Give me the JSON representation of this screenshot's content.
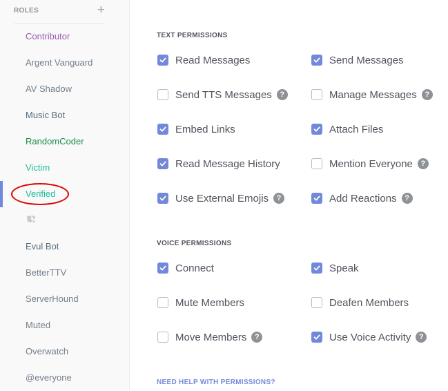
{
  "sidebar": {
    "title": "ROLES",
    "add_icon": "+",
    "items": [
      {
        "label": "Contributor",
        "color": "#9b59b6",
        "selected": false
      },
      {
        "label": "Argent Vanguard",
        "color": "#737f8d",
        "selected": false
      },
      {
        "label": "AV Shadow",
        "color": "#737f8d",
        "selected": false
      },
      {
        "label": "Music Bot",
        "color": "#546e7a",
        "selected": false
      },
      {
        "label": "RandomCoder",
        "color": "#1f8b4c",
        "selected": false
      },
      {
        "label": "Victim",
        "color": "#1abc9c",
        "selected": false
      },
      {
        "label": "Verified",
        "color": "#1abc9c",
        "selected": true
      },
      {
        "label": "",
        "icon": "broken-image-icon",
        "color": "#b9bbbe",
        "selected": false
      },
      {
        "label": "Evul Bot",
        "color": "#546e7a",
        "selected": false
      },
      {
        "label": "BetterTTV",
        "color": "#737f8d",
        "selected": false
      },
      {
        "label": "ServerHound",
        "color": "#737f8d",
        "selected": false
      },
      {
        "label": "Muted",
        "color": "#737f8d",
        "selected": false
      },
      {
        "label": "Overwatch",
        "color": "#737f8d",
        "selected": false
      },
      {
        "label": "@everyone",
        "color": "#737f8d",
        "selected": false
      }
    ]
  },
  "text_permissions": {
    "title": "TEXT PERMISSIONS",
    "items": [
      {
        "label": "Read Messages",
        "checked": true,
        "help": false
      },
      {
        "label": "Send Messages",
        "checked": true,
        "help": false
      },
      {
        "label": "Send TTS Messages",
        "checked": false,
        "help": true
      },
      {
        "label": "Manage Messages",
        "checked": false,
        "help": true
      },
      {
        "label": "Embed Links",
        "checked": true,
        "help": false
      },
      {
        "label": "Attach Files",
        "checked": true,
        "help": false
      },
      {
        "label": "Read Message History",
        "checked": true,
        "help": false
      },
      {
        "label": "Mention Everyone",
        "checked": false,
        "help": true
      },
      {
        "label": "Use External Emojis",
        "checked": true,
        "help": true
      },
      {
        "label": "Add Reactions",
        "checked": true,
        "help": true
      }
    ]
  },
  "voice_permissions": {
    "title": "VOICE PERMISSIONS",
    "items": [
      {
        "label": "Connect",
        "checked": true,
        "help": false
      },
      {
        "label": "Speak",
        "checked": true,
        "help": false
      },
      {
        "label": "Mute Members",
        "checked": false,
        "help": false
      },
      {
        "label": "Deafen Members",
        "checked": false,
        "help": false
      },
      {
        "label": "Move Members",
        "checked": false,
        "help": true
      },
      {
        "label": "Use Voice Activity",
        "checked": true,
        "help": true
      }
    ]
  },
  "help_icon_glyph": "?",
  "help_link": "NEED HELP WITH PERMISSIONS?",
  "colors": {
    "accent": "#7289da",
    "highlight": "#e10000"
  }
}
